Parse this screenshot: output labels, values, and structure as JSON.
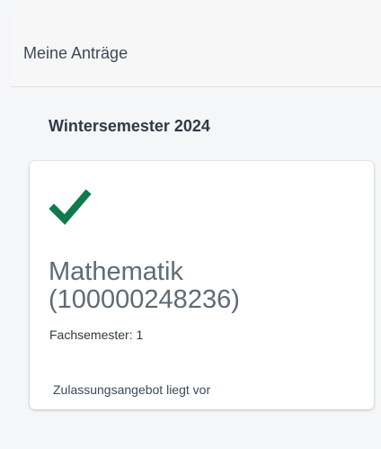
{
  "header": {
    "title": "Meine Anträge"
  },
  "section": {
    "title": "Wintersemester 2024"
  },
  "application_card": {
    "status_icon": "checkmark-icon",
    "program": "Mathematik (100000248236)",
    "semester_label": "Fachsemester:",
    "semester_value": "1",
    "status_text": "Zulassungsangebot liegt vor"
  },
  "colors": {
    "background": "#f5f6f7",
    "card_background": "#ffffff",
    "check_green": "#0f7a4b",
    "title_text": "#2f3a45",
    "muted_text": "#5f6b76"
  }
}
